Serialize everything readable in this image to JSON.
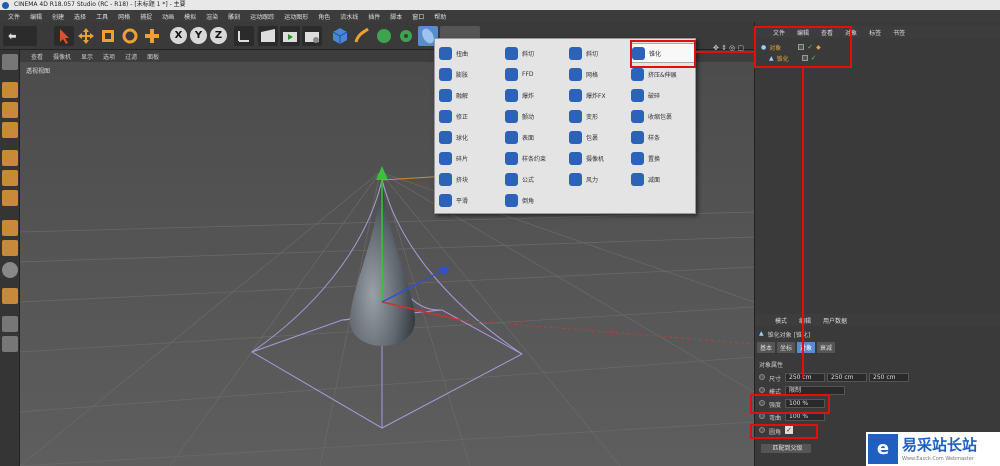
{
  "window": {
    "title": "CINEMA 4D R18.057 Studio (RC - R18) - [未标题 1 *] - 主要"
  },
  "menubar": [
    "文件",
    "编辑",
    "创建",
    "选择",
    "工具",
    "网格",
    "捕捉",
    "动画",
    "模拟",
    "渲染",
    "雕刻",
    "运动跟踪",
    "运动图形",
    "角色",
    "流水线",
    "插件",
    "脚本",
    "窗口",
    "帮助"
  ],
  "toolbar": {
    "axes": [
      "X",
      "Y",
      "Z"
    ]
  },
  "viewport": {
    "header_menu": [
      "查看",
      "摄像机",
      "显示",
      "选项",
      "过滤",
      "面板"
    ],
    "label": "透视视图"
  },
  "deformer_menu": {
    "columns": [
      [
        "扭曲",
        "膨胀",
        "融解",
        "修正",
        "球化",
        "碎片",
        "挤块",
        "平滑"
      ],
      [
        "斜切",
        "FFD",
        "爆炸",
        "颤动",
        "表面",
        "样条约束",
        "公式",
        "倒角"
      ],
      [
        "锥化",
        "网格",
        "爆炸FX",
        "变形",
        "包裹",
        "摄像机",
        "风力",
        ""
      ],
      [
        "锥化",
        "挤压&伸展",
        "破碎",
        "收缩包裹",
        "样条",
        "置换",
        "减面",
        ""
      ]
    ],
    "column_labels": [
      [
        "扭曲",
        "膨胀",
        "融解",
        "修正",
        "球化",
        "碎片",
        "挤块",
        "平滑"
      ],
      [
        "斜切",
        "FFD",
        "爆炸",
        "颤动",
        "表面",
        "样条约束",
        "公式",
        "倒角"
      ],
      [
        "斜切",
        "网格",
        "爆炸FX",
        "变形",
        "包裹",
        "摄像机",
        "风力"
      ],
      [
        "锥化",
        "挤压&伸展",
        "破碎",
        "收缩包裹",
        "样条",
        "置换",
        "减面"
      ]
    ],
    "highlighted": "锥化"
  },
  "object_manager": {
    "menu": [
      "文件",
      "编辑",
      "查看",
      "对象",
      "标签",
      "书签"
    ],
    "objects": [
      {
        "name": "对象"
      },
      {
        "name": "锥化"
      }
    ]
  },
  "attribute_manager": {
    "menu": [
      "模式",
      "编辑",
      "用户数据"
    ],
    "object_title": "锥化对象 [锥化]",
    "tabs": [
      "基本",
      "坐标",
      "对象",
      "衰减"
    ],
    "active_tab": "对象",
    "section": "对象属性",
    "size_label": "尺寸",
    "size_values": [
      "250 cm",
      "250 cm",
      "250 cm"
    ],
    "mode_label": "模式",
    "mode_value": "限制",
    "strength_label": "强度",
    "strength_value": "100 %",
    "curvature_label": "弯曲",
    "curvature_value": "100 %",
    "rounded_label": "圆角",
    "fit_button": "匹配到父级"
  },
  "watermark": {
    "text": "易采站长站",
    "sub": "Www.Easck.Com  Webmaster"
  },
  "colors": {
    "highlight_red": "#e01010",
    "selection_blue": "#5a8bd1",
    "object_orange": "#e0a33a"
  }
}
